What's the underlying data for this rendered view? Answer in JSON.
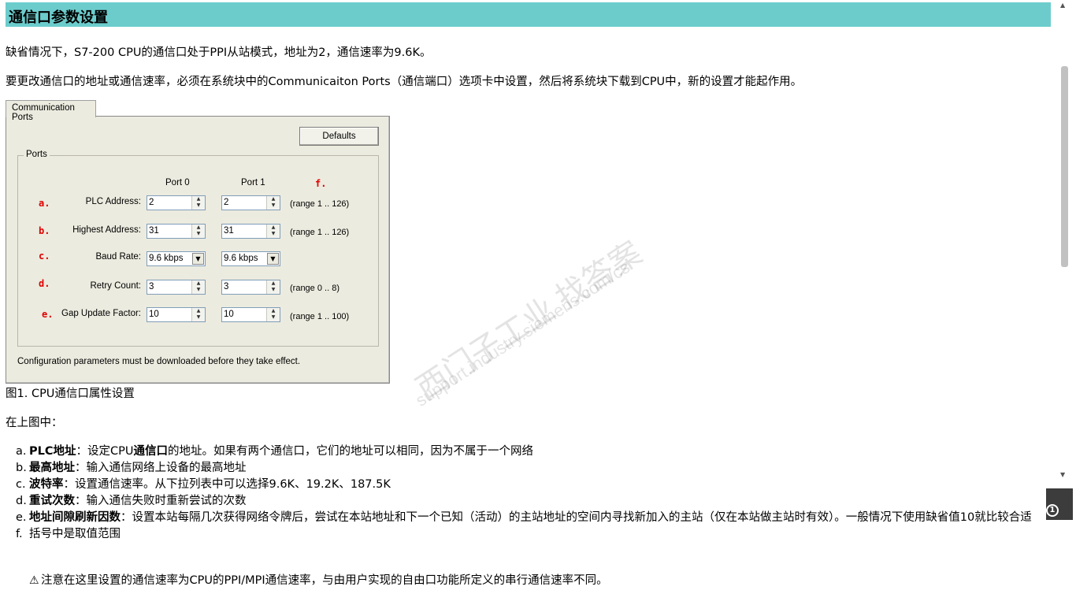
{
  "page": {
    "title": "通信口参数设置",
    "intro1": "缺省情况下，S7-200 CPU的通信口处于PPI从站模式，地址为2，通信速率为9.6K。",
    "intro2": "要更改通信口的地址或通信速率，必须在系统块中的Communicaiton Ports（通信端口）选项卡中设置，然后将系统块下载到CPU中，新的设置才能起作用。",
    "figure_caption": "图1. CPU通信口属性设置",
    "in_figure": "在上图中："
  },
  "dialog": {
    "tab_label": "Communication Ports",
    "defaults_button": "Defaults",
    "group_label": "Ports",
    "port0_header": "Port 0",
    "port1_header": "Port 1",
    "col_f_mark": "f.",
    "rows": [
      {
        "mark": "a.",
        "label": "PLC Address:",
        "port0": "2",
        "port1": "2",
        "range": "(range 1 .. 126)"
      },
      {
        "mark": "b.",
        "label": "Highest Address:",
        "port0": "31",
        "port1": "31",
        "range": "(range 1 .. 126)"
      },
      {
        "mark": "c.",
        "label": "Baud Rate:",
        "port0": "9.6 kbps",
        "port1": "9.6 kbps",
        "range": ""
      },
      {
        "mark": "d.",
        "label": "Retry Count:",
        "port0": "3",
        "port1": "3",
        "range": "(range 0 .. 8)"
      },
      {
        "mark": "e.",
        "label": "Gap Update Factor:",
        "port0": "10",
        "port1": "10",
        "range": "(range 1 .. 100)"
      }
    ],
    "footer_note": "Configuration parameters must be downloaded before they take effect."
  },
  "watermark": {
    "line1": "西门子工业   找答案",
    "line2": "support.industry.siemens.com/cs"
  },
  "list": [
    {
      "marker": "a.",
      "term": "PLC地址",
      "pre": "：设定CPU",
      "bold_mid": "通信口",
      "post": "的地址。如果有两个通信口，它们的地址可以相同，因为不属于一个网络"
    },
    {
      "marker": "b.",
      "term": "最高地址",
      "pre": "：输入通信网络上设备的最高地址",
      "bold_mid": "",
      "post": ""
    },
    {
      "marker": "c.",
      "term": "波特率",
      "pre": "：设置通信速率。从下拉列表中可以选择9.6K、19.2K、187.5K",
      "bold_mid": "",
      "post": ""
    },
    {
      "marker": "d.",
      "term": "重试次数",
      "pre": "：输入通信失败时重新尝试的次数",
      "bold_mid": "",
      "post": ""
    },
    {
      "marker": "e.",
      "term": "地址间隙刷新因数",
      "pre": "：设置本站每隔几次获得网络令牌后，尝试在本站地址和下一个已知（活动）的主站地址的空间内寻找新加入的主站（仅在本站做主站时有效）。一般情况下使用缺省值10就比较合适",
      "bold_mid": "",
      "post": ""
    },
    {
      "marker": "f.",
      "term": "",
      "pre": "括号中是取值范围",
      "bold_mid": "",
      "post": ""
    }
  ],
  "note": "注意在这里设置的通信速率为CPU的PPI/MPI通信速率，与由用户实现的自由口功能所定义的串行通信速率不同。",
  "side_badge": "1"
}
